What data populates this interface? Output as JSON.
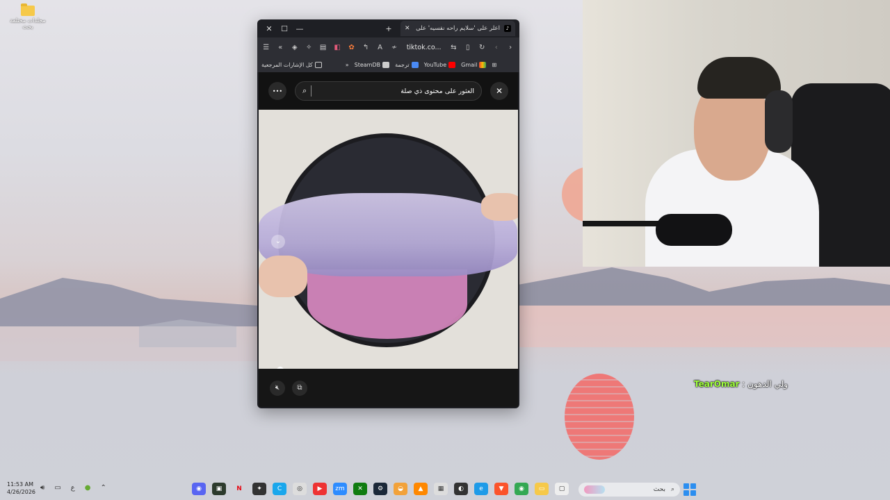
{
  "desktop": {
    "icon_label": "مجلدات مختلفة بحث"
  },
  "browser": {
    "tab_title": "اعلر على 'سلايم راحه نفسيه' على",
    "tab_logo": "♪",
    "window_controls": {
      "close": "✕",
      "maximize": "☐",
      "minimize": "—",
      "new_tab": "+",
      "tab_close": "✕"
    },
    "url": "tiktok.co...",
    "bookmarks": [
      "كل الإشارات المرجعية",
      "SteamDB",
      "ترجمة",
      "YouTube",
      "Gmail"
    ],
    "more_bookmarks": "»"
  },
  "tiktok": {
    "search_placeholder": "العثور على محتوى ذي صلة",
    "more_button": "•••",
    "close_button": "✕"
  },
  "chat": {
    "name": "TearOmar",
    "separator": " : ",
    "message": "ولي الدهون"
  },
  "taskbar": {
    "time": "11:53 AM",
    "date": "4/26/2026",
    "lang": "ع",
    "search_placeholder": "بحث"
  },
  "colors": {
    "accent_pink": "#f26e6c",
    "chat_name": "#9fff3c",
    "browser_bg": "#1e1f24"
  }
}
